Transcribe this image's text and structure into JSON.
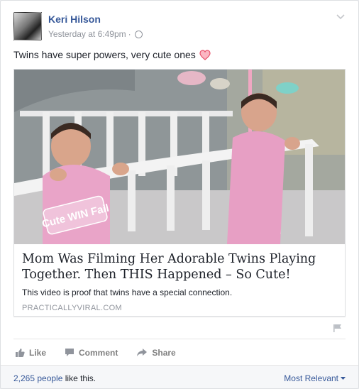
{
  "post": {
    "author": "Keri Hilson",
    "timestamp": "Yesterday at 6:49pm",
    "separator": "·",
    "privacy_icon": "globe-icon",
    "status_text": "Twins have super powers, very cute ones",
    "status_emoji": "heart-icon"
  },
  "link_card": {
    "watermark": "Cute WIN Fail",
    "title": "Mom Was Filming Her Adorable Twins Playing Together. Then THIS Happened – So Cute!",
    "description": "This video is proof that twins have a special connection.",
    "domain": "PRACTICALLYVIRAL.COM"
  },
  "actions": {
    "like": "Like",
    "comment": "Comment",
    "share": "Share"
  },
  "footer": {
    "likes_count": "2,265 people",
    "likes_suffix": " like this.",
    "sort_label": "Most Relevant"
  },
  "colors": {
    "link_blue": "#365899",
    "meta_gray": "#90949c",
    "text": "#1d2129",
    "heart": "#f25268"
  }
}
